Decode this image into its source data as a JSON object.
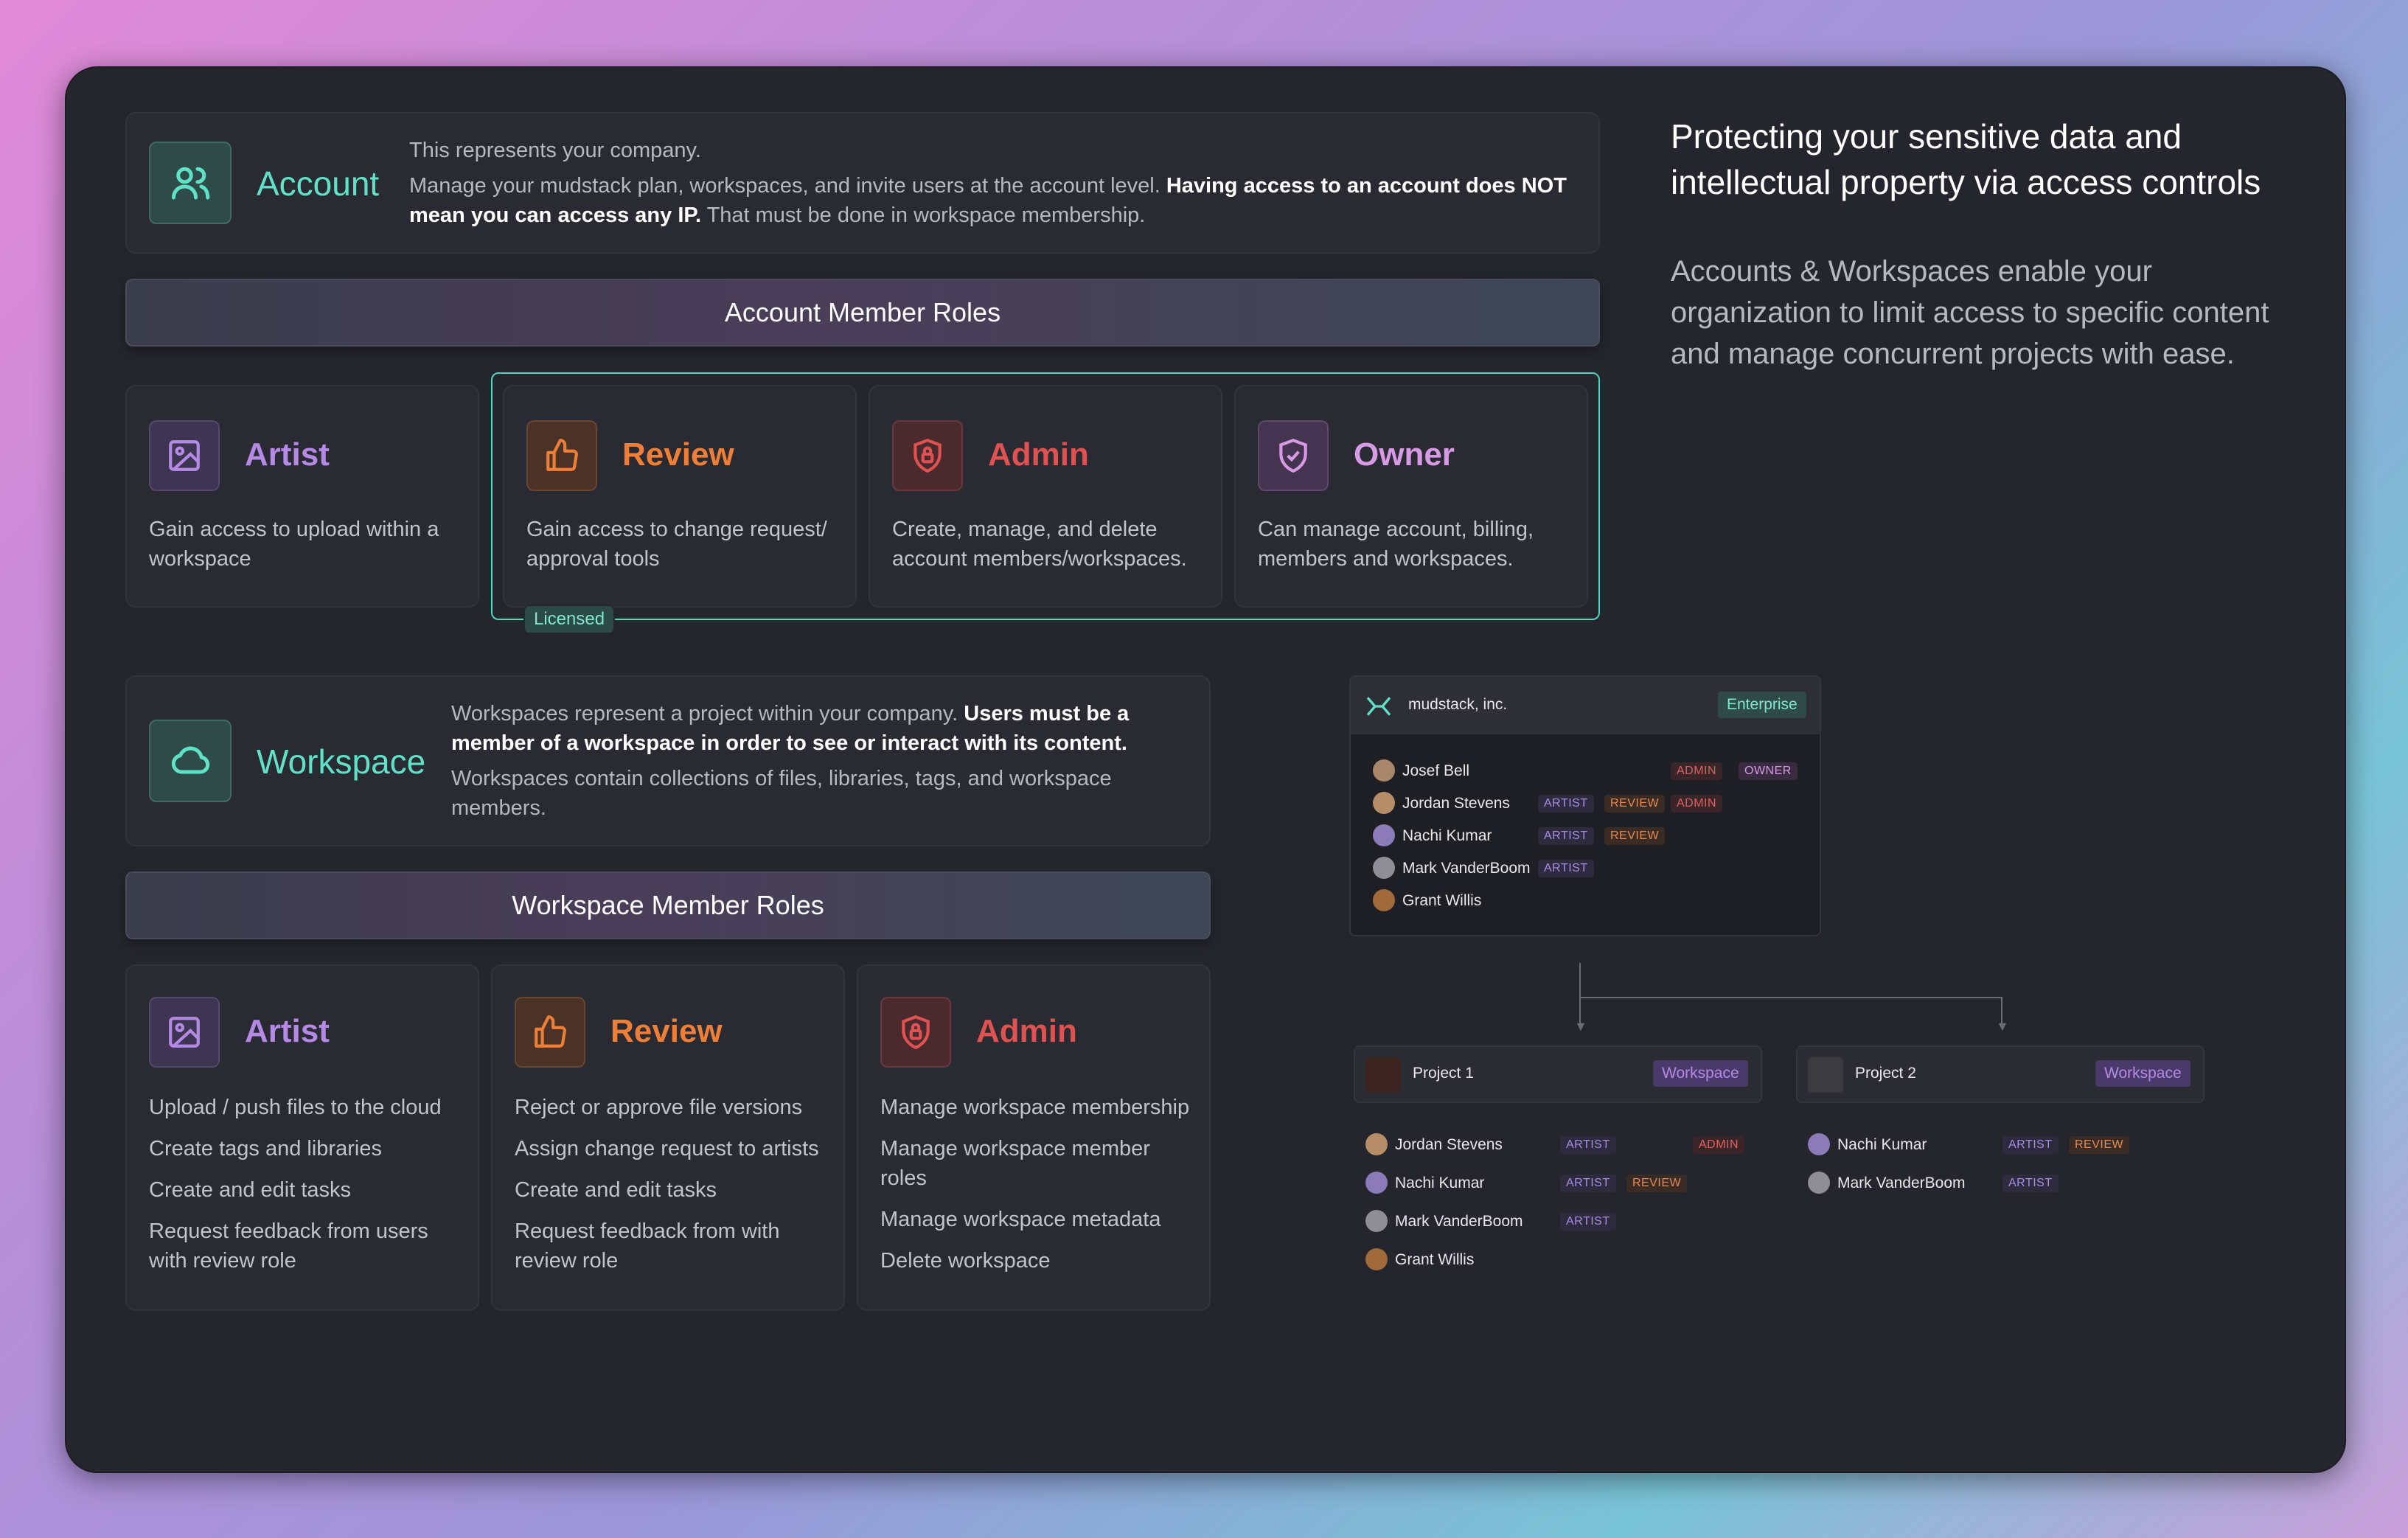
{
  "account": {
    "title": "Account",
    "line1": "This represents your company.",
    "line2a": "Manage your mudstack plan, workspaces, and invite users at the account level. ",
    "line2b": "Having access to an account does NOT mean you can access any IP.",
    "line2c": " That must be done in workspace membership."
  },
  "account_roles": {
    "banner": "Account Member Roles",
    "licensed": "Licensed",
    "roles": [
      {
        "title": "Artist",
        "desc": "Gain access to upload within a workspace",
        "icon": "image-icon",
        "color": "#b58ae6"
      },
      {
        "title": "Review",
        "desc": "Gain access to change request/ approval tools",
        "icon": "thumbs-up-icon",
        "color": "#ef7f36"
      },
      {
        "title": "Admin",
        "desc": "Create, manage, and delete account members/workspaces.",
        "icon": "lock-shield-icon",
        "color": "#e05252"
      },
      {
        "title": "Owner",
        "desc": "Can manage account, billing, members and workspaces.",
        "icon": "shield-check-icon",
        "color": "#d79be6"
      }
    ]
  },
  "workspace": {
    "title": "Workspace",
    "line1a": "Workspaces represent a project within your company. ",
    "line1b": "Users must be a member of a workspace in order to see or interact with its content.",
    "line2": "Workspaces contain collections of files, libraries, tags, and workspace members."
  },
  "workspace_roles": {
    "banner": "Workspace Member Roles",
    "roles": [
      {
        "title": "Artist",
        "icon": "image-icon",
        "items": [
          "Upload / push files to the cloud",
          "Create tags and libraries",
          "Create and edit tasks",
          "Request feedback from users with review role"
        ]
      },
      {
        "title": "Review",
        "icon": "thumbs-up-icon",
        "items": [
          "Reject or approve file versions",
          "Assign change request to artists",
          "Create and edit tasks",
          "Request feedback from with review role"
        ]
      },
      {
        "title": "Admin",
        "icon": "lock-shield-icon",
        "items": [
          "Manage workspace membership",
          "Manage workspace member roles",
          "Manage workspace metadata",
          "Delete workspace"
        ]
      }
    ]
  },
  "side": {
    "heading": "Protecting your sensitive data and intellectual property via access controls",
    "sub": "Accounts & Workspaces enable your organization to limit access to specific content and manage concurrent projects with ease."
  },
  "org": {
    "name": "mudstack, inc.",
    "plan": "Enterprise",
    "members": [
      {
        "name": "Josef Bell",
        "badges": [
          "ADMIN",
          "OWNER"
        ]
      },
      {
        "name": "Jordan Stevens",
        "badges": [
          "ARTIST",
          "REVIEW",
          "ADMIN"
        ]
      },
      {
        "name": "Nachi Kumar",
        "badges": [
          "ARTIST",
          "REVIEW"
        ]
      },
      {
        "name": "Mark VanderBoom",
        "badges": [
          "ARTIST"
        ]
      },
      {
        "name": "Grant Willis",
        "badges": []
      }
    ],
    "project1": {
      "name": "Project 1",
      "tag": "Workspace",
      "members": [
        {
          "name": "Jordan Stevens",
          "badges": [
            "ARTIST",
            "ADMIN"
          ]
        },
        {
          "name": "Nachi Kumar",
          "badges": [
            "ARTIST",
            "REVIEW"
          ]
        },
        {
          "name": "Mark VanderBoom",
          "badges": [
            "ARTIST"
          ]
        },
        {
          "name": "Grant Willis",
          "badges": []
        }
      ]
    },
    "project2": {
      "name": "Project 2",
      "tag": "Workspace",
      "members": [
        {
          "name": "Nachi Kumar",
          "badges": [
            "ARTIST",
            "REVIEW"
          ]
        },
        {
          "name": "Mark VanderBoom",
          "badges": [
            "ARTIST"
          ]
        }
      ]
    }
  }
}
